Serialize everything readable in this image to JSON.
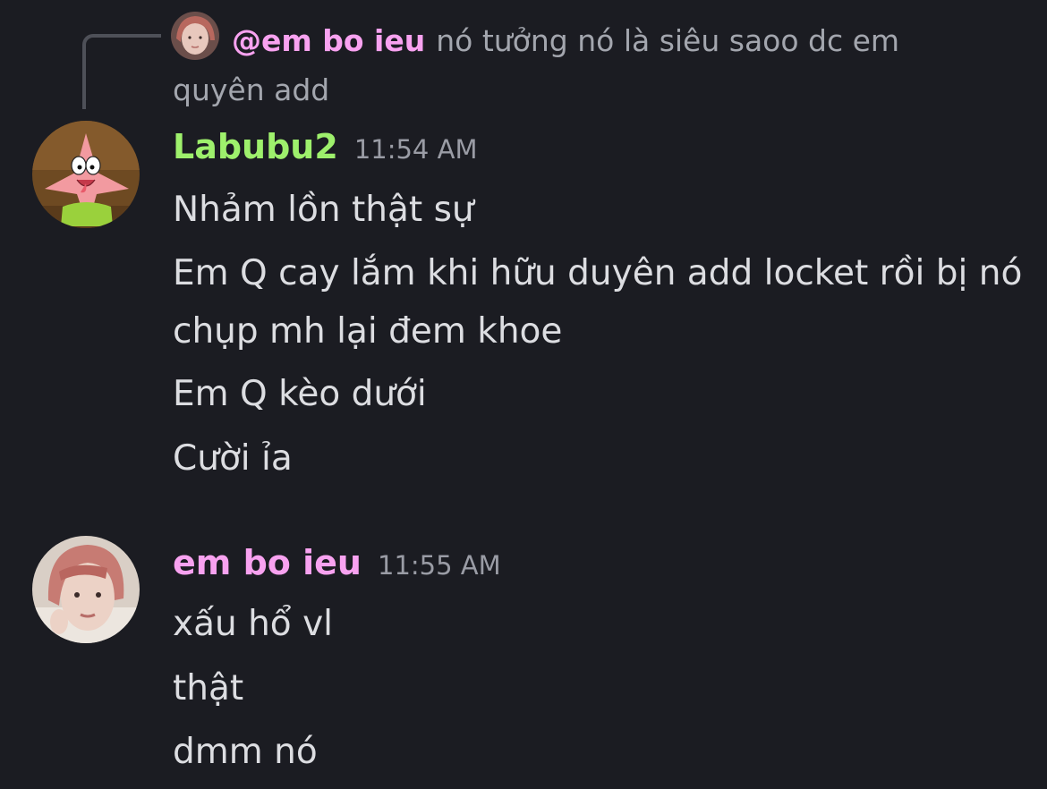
{
  "reply": {
    "author": "@em bo ieu",
    "text": "nó tưởng nó là siêu saoo dc em quyên add",
    "avatar_icon": "girl-portrait-avatar-icon"
  },
  "messages": [
    {
      "author": "Labubu2",
      "timestamp": "11:54 AM",
      "author_color": "#9ef06c",
      "avatar_icon": "patrick-star-avatar-icon",
      "lines": [
        "Nhảm lồn thật sự",
        "Em Q cay lắm khi hữu duyên add locket rồi bị nó chụp mh lại đem khoe",
        "Em Q kèo dưới",
        "Cười ỉa"
      ]
    },
    {
      "author": "em bo ieu",
      "timestamp": "11:55 AM",
      "author_color": "#f8a2f0",
      "avatar_icon": "girl-portrait-avatar-icon",
      "lines": [
        "xấu hổ vl",
        "thật",
        "dmm nó"
      ]
    }
  ],
  "colors": {
    "background": "#1b1c22",
    "message_text": "#dcdde1",
    "muted_text": "#a3a6ae",
    "timestamp": "#9a9ca5"
  }
}
